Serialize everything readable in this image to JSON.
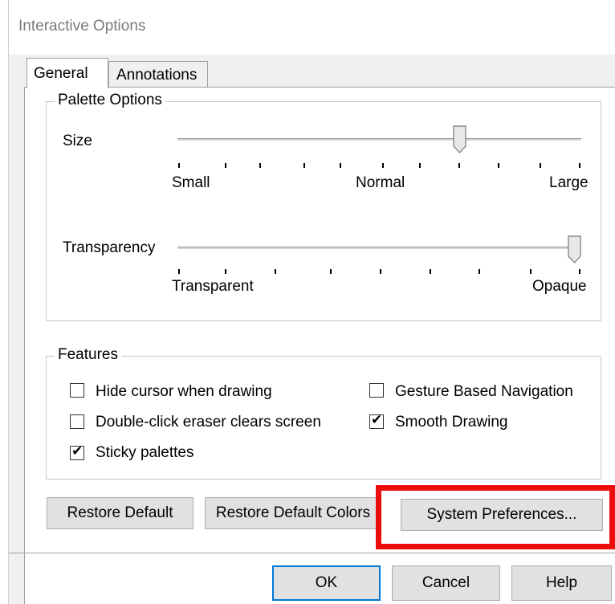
{
  "window": {
    "title": "Interactive Options"
  },
  "tabs": [
    {
      "label": "General",
      "active": true
    },
    {
      "label": "Annotations",
      "active": false
    }
  ],
  "palette_options": {
    "group_label": "Palette Options",
    "size": {
      "label": "Size",
      "min_label": "Small",
      "mid_label": "Normal",
      "max_label": "Large",
      "value_fraction": 0.7
    },
    "transparency": {
      "label": "Transparency",
      "min_label": "Transparent",
      "max_label": "Opaque",
      "value_fraction": 1.0
    }
  },
  "features": {
    "group_label": "Features",
    "items": [
      {
        "label": "Hide cursor when drawing",
        "checked": false
      },
      {
        "label": "Double-click eraser clears screen",
        "checked": false
      },
      {
        "label": "Sticky palettes",
        "checked": true
      },
      {
        "label": "Gesture Based Navigation",
        "checked": false
      },
      {
        "label": "Smooth Drawing",
        "checked": true
      }
    ]
  },
  "buttons": {
    "restore_default": "Restore Default",
    "restore_default_colors": "Restore Default Colors",
    "system_preferences": "System Preferences...",
    "ok": "OK",
    "cancel": "Cancel",
    "help": "Help"
  },
  "colors": {
    "highlight": "#ee0d0d",
    "dialog_bg": "#f0f0f0",
    "panel_bg": "#ffffff",
    "focus_border": "#0078d7"
  }
}
